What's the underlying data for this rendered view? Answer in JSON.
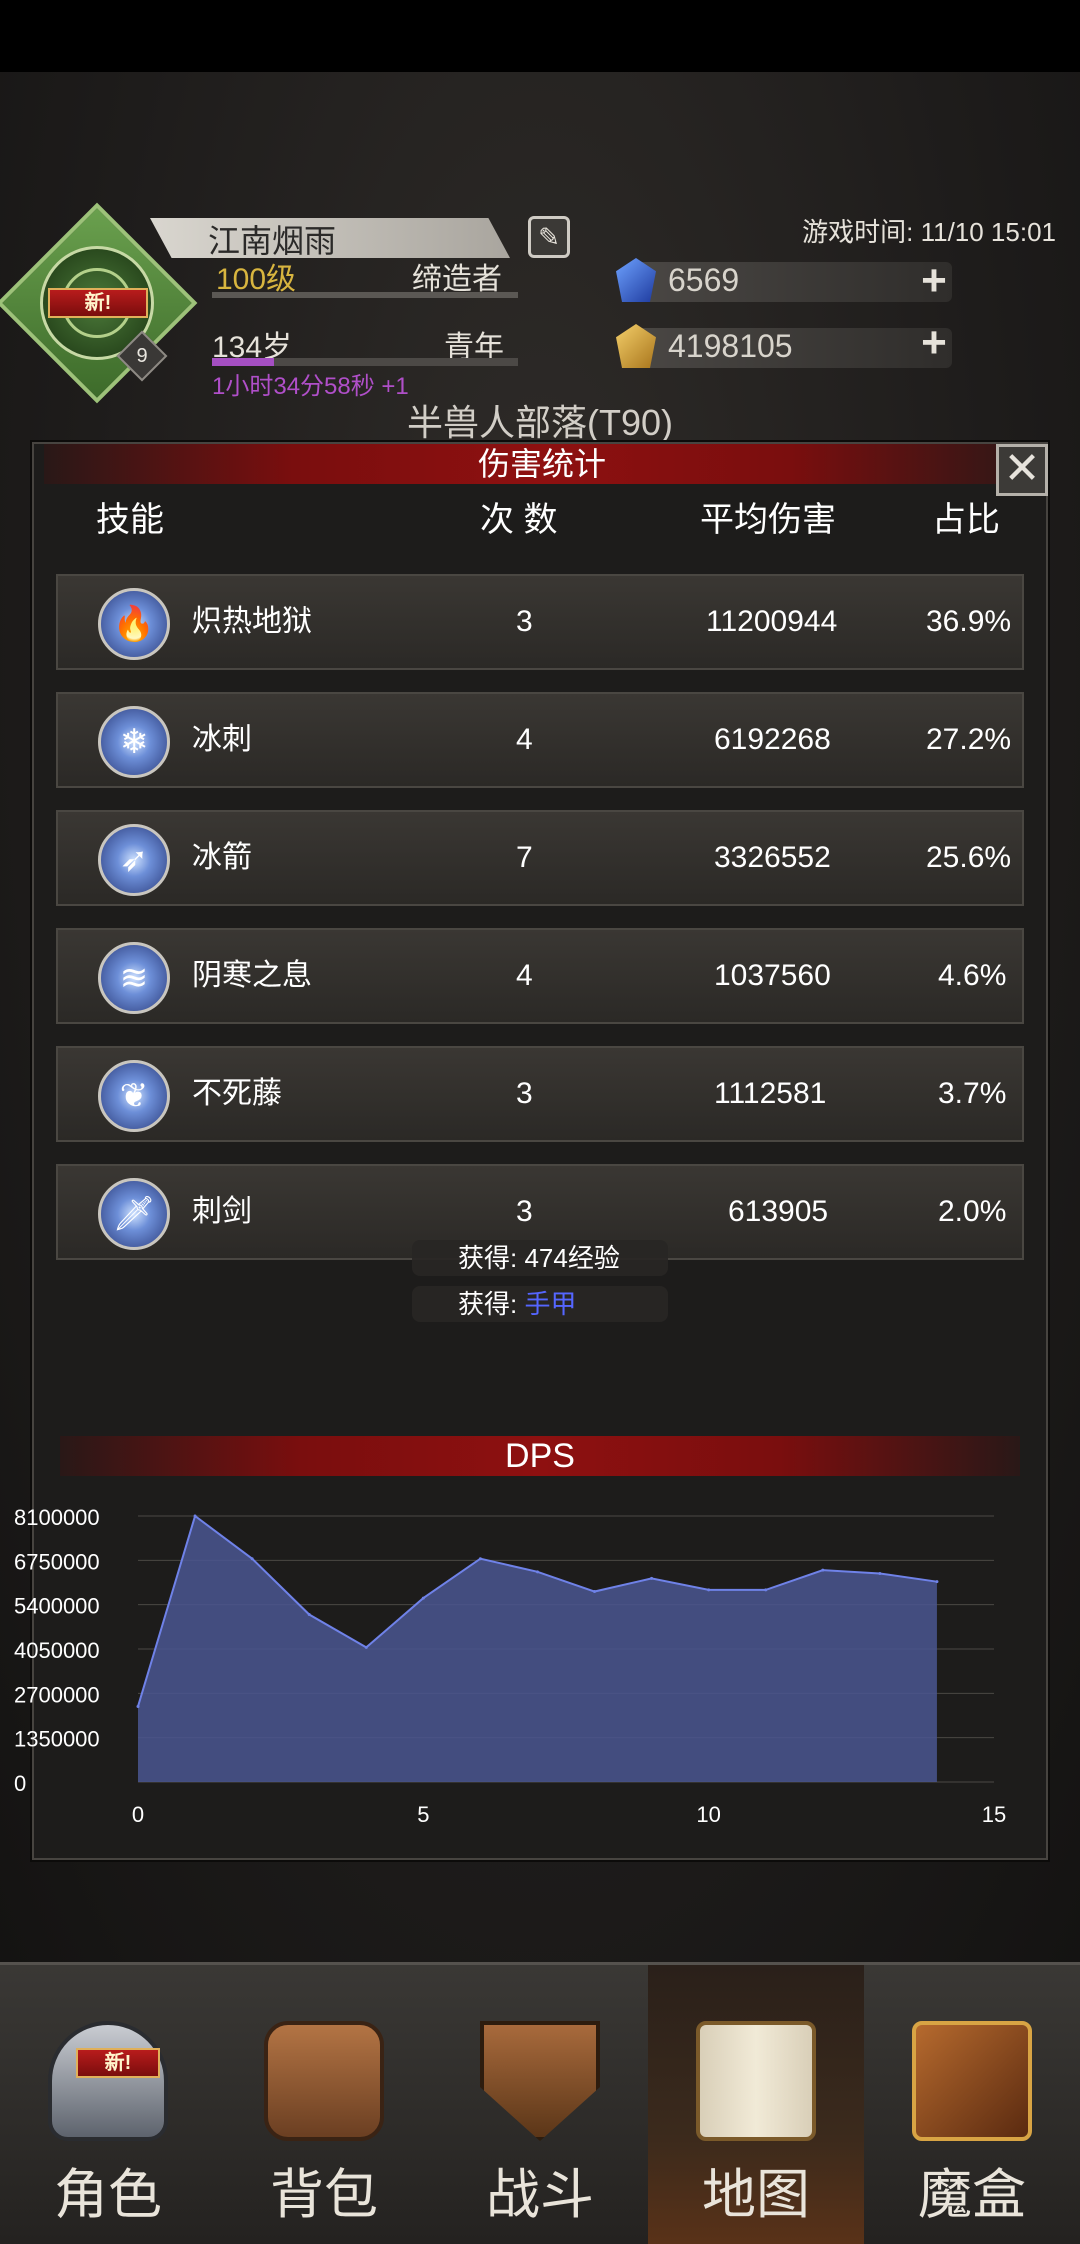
{
  "header": {
    "player_name": "江南烟雨",
    "level": "100级",
    "class": "缔造者",
    "age": "134岁",
    "life_stage": "青年",
    "timer": "1小时34分58秒 +1",
    "avatar_new_tag": "新!",
    "avatar_badge": "9",
    "game_time": "游戏时间: 11/10 15:01",
    "gems": "6569",
    "gold": "4198105",
    "map_title": "半兽人部落(T90)"
  },
  "panel": {
    "title": "伤害统计",
    "close_glyph": "✕",
    "columns": {
      "skill": "技能",
      "count": "次 数",
      "avg": "平均伤害",
      "share": "占比"
    },
    "rows": [
      {
        "name": "炽热地狱",
        "count": "3",
        "avg": "11200944",
        "share": "36.9%",
        "icon": "flame-icon"
      },
      {
        "name": "冰刺",
        "count": "4",
        "avg": "6192268",
        "share": "27.2%",
        "icon": "ice-spike-icon"
      },
      {
        "name": "冰箭",
        "count": "7",
        "avg": "3326552",
        "share": "25.6%",
        "icon": "ice-arrow-icon"
      },
      {
        "name": "阴寒之息",
        "count": "4",
        "avg": "1037560",
        "share": "4.6%",
        "icon": "frost-breath-icon"
      },
      {
        "name": "不死藤",
        "count": "3",
        "avg": "1112581",
        "share": "3.7%",
        "icon": "undead-vine-icon"
      },
      {
        "name": "刺剑",
        "count": "3",
        "avg": "613905",
        "share": "2.0%",
        "icon": "rapier-icon"
      }
    ],
    "toasts": {
      "exp_prefix": "获得: ",
      "exp_value": "474经验",
      "loot_prefix": "获得: ",
      "loot_value": "手甲"
    }
  },
  "chart_data": {
    "type": "area",
    "title": "DPS",
    "x": [
      0,
      1,
      2,
      3,
      4,
      5,
      6,
      7,
      8,
      9,
      10,
      11,
      12,
      13,
      14
    ],
    "values": [
      2300000,
      8100000,
      6800000,
      5100000,
      4100000,
      5600000,
      6800000,
      6400000,
      5800000,
      6200000,
      5850000,
      5850000,
      6450000,
      6350000,
      6100000
    ],
    "xlim": [
      0,
      15
    ],
    "ylim": [
      0,
      8100000
    ],
    "xticks": [
      "0",
      "5",
      "10",
      "15"
    ],
    "yticks": [
      "0",
      "1350000",
      "2700000",
      "4050000",
      "5400000",
      "6750000",
      "8100000"
    ],
    "line_color": "#6f82e8",
    "fill_color": "#4a5690"
  },
  "nav": {
    "items": [
      {
        "label": "角色",
        "icon": "helmet-icon"
      },
      {
        "label": "背包",
        "icon": "backpack-icon"
      },
      {
        "label": "战斗",
        "icon": "sword-shield-icon"
      },
      {
        "label": "地图",
        "icon": "scroll-map-icon"
      },
      {
        "label": "魔盒",
        "icon": "magic-box-icon"
      }
    ],
    "active_index": 3,
    "new_tag": "新!"
  }
}
